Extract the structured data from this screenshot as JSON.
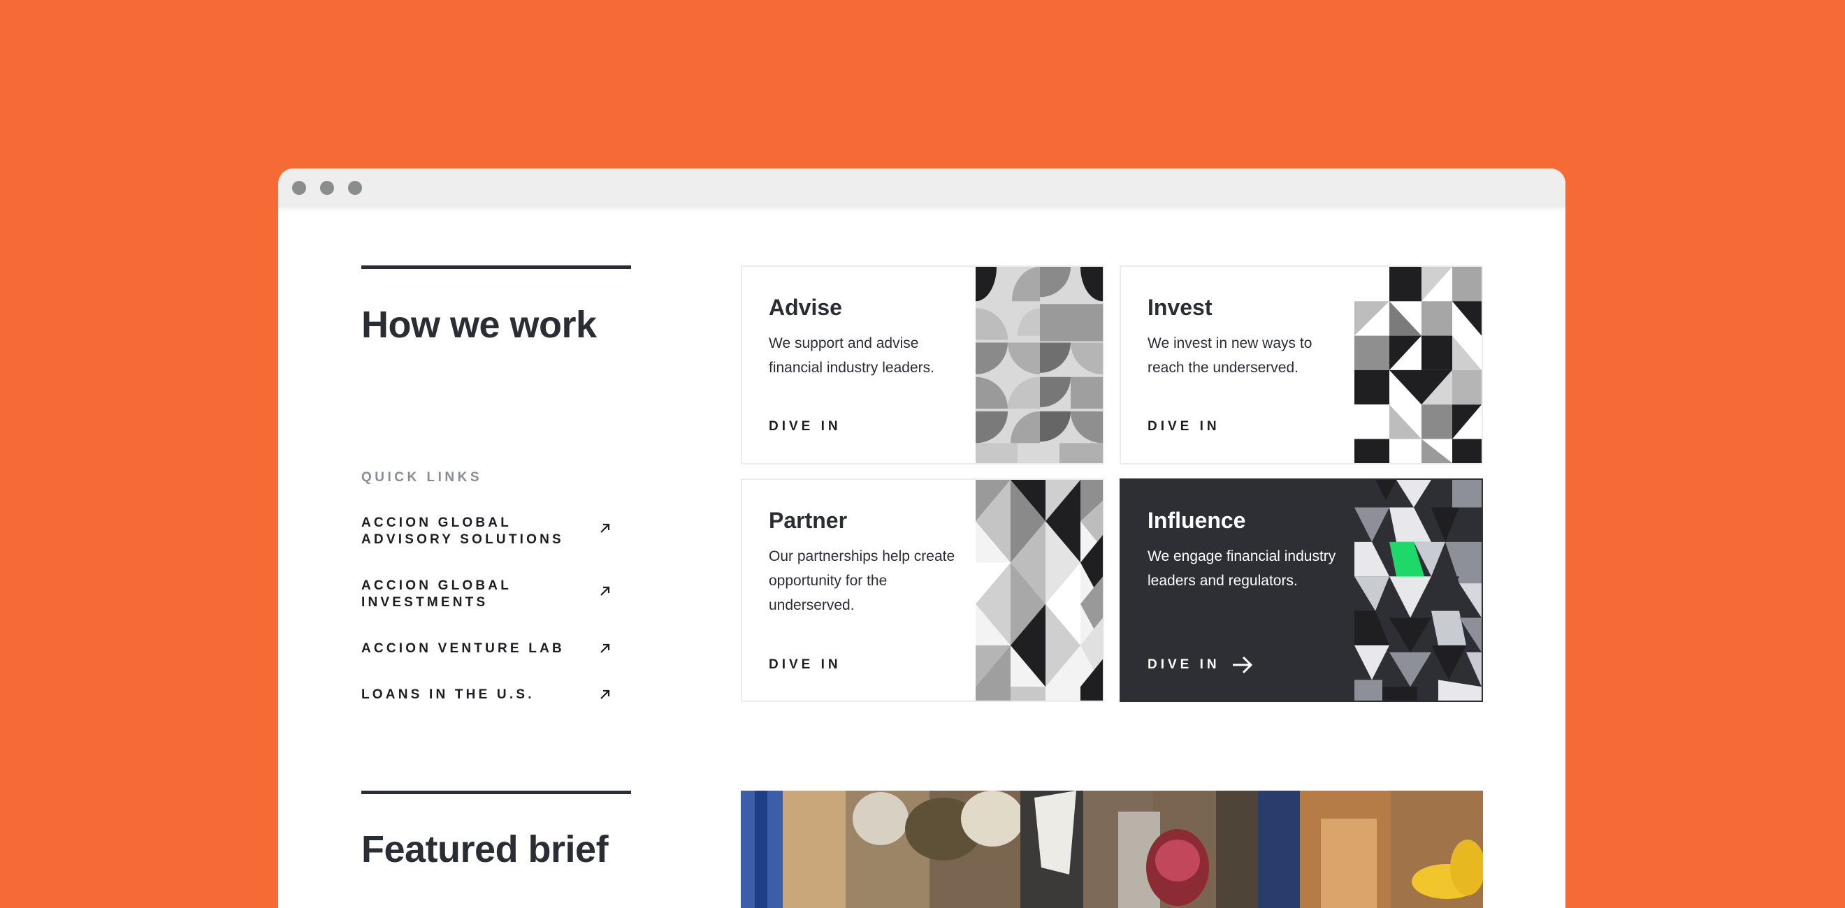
{
  "page": {
    "background_color": "#f56a35",
    "window_color": "#ffffff",
    "text_color": "#2b2d34",
    "accent_green": "#1fd86a"
  },
  "how_we_work": {
    "title": "How we work"
  },
  "quick_links": {
    "heading": "QUICK LINKS",
    "items": [
      {
        "label": "ACCION GLOBAL ADVISORY SOLUTIONS",
        "icon": "arrow-up-right-icon"
      },
      {
        "label": "ACCION GLOBAL INVESTMENTS",
        "icon": "arrow-up-right-icon"
      },
      {
        "label": "ACCION VENTURE LAB",
        "icon": "arrow-up-right-icon"
      },
      {
        "label": "LOANS IN THE U.S.",
        "icon": "arrow-up-right-icon"
      }
    ]
  },
  "cards": [
    {
      "title": "Advise",
      "description": "We support and advise financial industry leaders.",
      "cta": "DIVE IN"
    },
    {
      "title": "Invest",
      "description": "We invest in new ways to reach the underserved.",
      "cta": "DIVE IN"
    },
    {
      "title": "Partner",
      "description": "Our partnerships help create opportunity for the underserved.",
      "cta": "DIVE IN"
    },
    {
      "title": "Influence",
      "description": "We engage financial industry leaders and regulators.",
      "cta": "DIVE IN",
      "cta_icon": "arrow-right-icon"
    }
  ],
  "featured_brief": {
    "title": "Featured brief"
  }
}
